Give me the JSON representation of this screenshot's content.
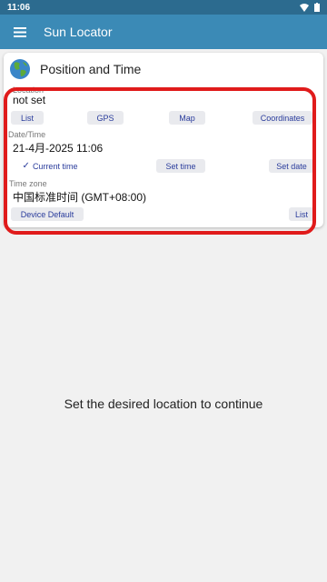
{
  "status": {
    "time": "11:06"
  },
  "appbar": {
    "title": "Sun Locator"
  },
  "card": {
    "title": "Position and Time",
    "location": {
      "label": "Location",
      "value": "not set",
      "buttons": {
        "list": "List",
        "gps": "GPS",
        "map": "Map",
        "coordinates": "Coordinates"
      }
    },
    "datetime": {
      "label": "Date/Time",
      "value": "21-4月-2025 11:06",
      "buttons": {
        "current": "Current time",
        "set_time": "Set time",
        "set_date": "Set date"
      }
    },
    "timezone": {
      "label": "Time zone",
      "value": "中国标准时间 (GMT+08:00)",
      "buttons": {
        "device_default": "Device Default",
        "list": "List"
      }
    }
  },
  "main": {
    "message": "Set the desired location to continue"
  },
  "colors": {
    "appbar": "#3b8ab6",
    "statusbar": "#2c6b8f",
    "highlight": "#e01b1b",
    "button_text": "#2a3c9c"
  }
}
